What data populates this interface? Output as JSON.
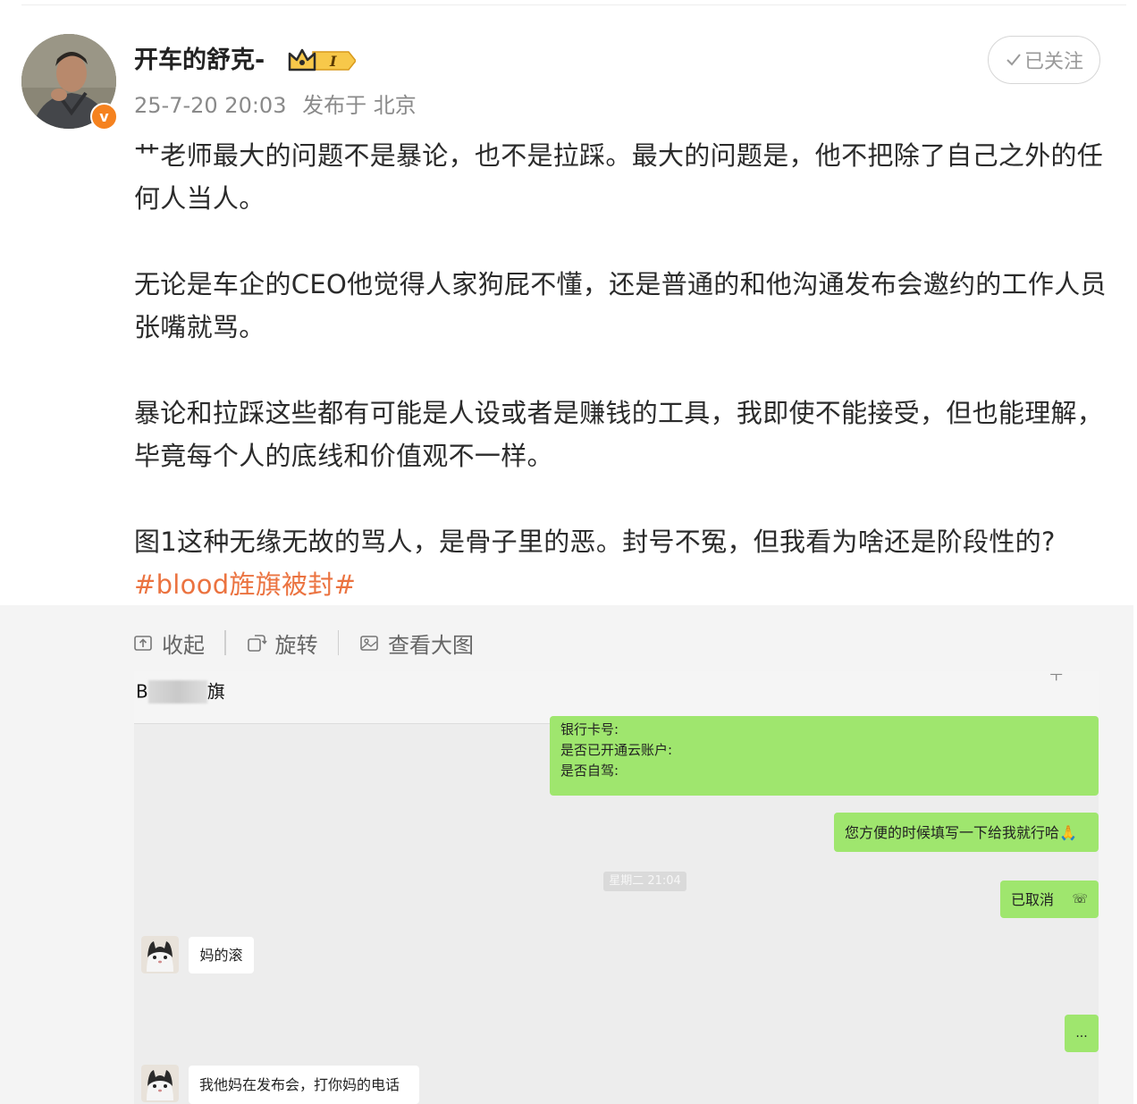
{
  "post": {
    "author": "开车的舒克-",
    "vip_badge": "I",
    "timestamp": "25-7-20 20:03",
    "published_in": "发布于 北京",
    "follow_label": "已关注",
    "paragraphs": [
      "艹老师最大的问题不是暴论，也不是拉踩。最大的问题是，他不把除了自己之外的任何人当人。",
      "无论是车企的CEO他觉得人家狗屁不懂，还是普通的和他沟通发布会邀约的工作人员张嘴就骂。",
      "暴论和拉踩这些都有可能是人设或者是赚钱的工具，我即使不能接受，但也能理解，毕竟每个人的底线和价值观不一样。",
      "图1这种无缘无故的骂人，是骨子里的恶。封号不冤，但我看为啥还是阶段性的?"
    ],
    "hashtag": "#blood旌旗被封#",
    "accent_color": "#eb7340"
  },
  "media_toolbar": {
    "collapse": "收起",
    "rotate": "旋转",
    "view_large": "查看大图"
  },
  "chat_screenshot": {
    "title_prefix": "B",
    "title_suffix": "旗",
    "form_lines": [
      "银行卡号:",
      "是否已开通云账户:",
      "是否自驾:"
    ],
    "msg_fill_in": "您方便的时候填写一下给我就行哈🙏",
    "time_label": "星期二 21:04",
    "msg_cancelled": "已取消",
    "msg_reply_1": "妈的滚",
    "msg_dots": "...",
    "msg_reply_2": "我他妈在发布会，打你妈的电话"
  }
}
